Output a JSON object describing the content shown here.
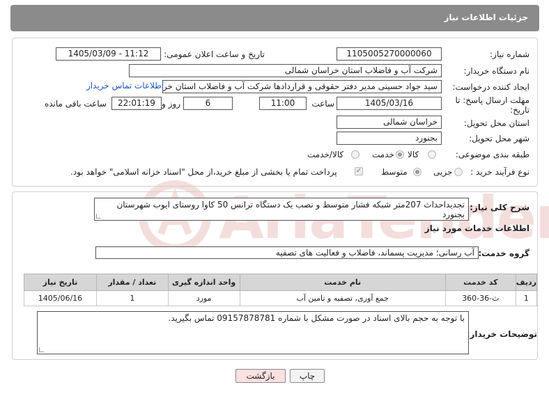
{
  "header": {
    "title": "جزئیات اطلاعات نیاز"
  },
  "form": {
    "need_number_label": "شماره نیاز:",
    "need_number": "1105005270000060",
    "announce_label": "تاریخ و ساعت اعلان عمومی:",
    "announce_value": "1405/03/09 - 11:12",
    "buyer_org_label": "نام دستگاه خریدار:",
    "buyer_org": "شرکت آب و فاضلاب استان خراسان شمالی",
    "creator_label": "ایجاد کننده درخواست:",
    "creator": "سید جواد حسینی مدیر دفتر حقوقی و قراردادها  شرکت آب و فاضلاب استان خراسان شمالی",
    "contact_link": "اطلاعات تماس خریدار",
    "deadline_label_1": "مهلت ارسال پاسخ: تا",
    "deadline_label_2": "تاریخ:",
    "deadline_date": "1405/03/16",
    "time_label": "ساعت",
    "deadline_time": "11:00",
    "days_value": "6",
    "days_label": "روز و",
    "remaining_time": "22:01:19",
    "remaining_label": "ساعت باقی مانده",
    "province_label": "استان محل تحویل:",
    "province": "خراسان شمالی",
    "city_label": "شهر محل تحویل:",
    "city": "بجنورد",
    "category_label": "طبقه بندی موضوعی:",
    "category_options": [
      "کالا",
      "خدمت",
      "کالا/خدمت"
    ],
    "category_selected": "خدمت",
    "process_label": "نوع فرآیند خرید :",
    "process_options": [
      "جزیی",
      "متوسط"
    ],
    "process_selected": "متوسط",
    "payment_note": "پرداخت تمام یا بخشی از مبلغ خرید،از محل \"اسناد خزانه اسلامی\" خواهد بود."
  },
  "description": {
    "label": "شرح کلی نیاز:",
    "text": "تجدیداحداث 207متر شبکه فشار متوسط و نصب یک دستگاه ترانس 50 کاوا روستای ایوب شهرستان بجنورد"
  },
  "services": {
    "section_title": "اطلاعات خدمات مورد نیاز",
    "group_label": "گروه خدمت:",
    "group_value": "آب رسانی؛ مدیریت پسماند، فاضلاب و فعالیت های تصفیه",
    "table": {
      "headers": [
        "ردیف",
        "کد خدمت",
        "نام خدمت",
        "واحد اندازه گیری",
        "تعداد / مقدار",
        "تاریخ نیاز"
      ],
      "rows": [
        [
          "1",
          "ث-36-360",
          "جمع آوری، تصفیه و تامین آب",
          "مورد",
          "1",
          "1405/06/16"
        ]
      ]
    }
  },
  "buyer_notes": {
    "label": "توضیحات خریدار:",
    "text": "با توجه به حجم بالای اسناد در صورت مشکل با شماره 09157878781 تماس بگیرید."
  },
  "buttons": {
    "print": "چاپ",
    "back": "بازگشت"
  },
  "watermark": {
    "text": "AriaTender.neT"
  },
  "colors": {
    "header_bg": "#8b8b8b",
    "link": "#1a57c8",
    "back_button": "#fde0e0",
    "table_header": "#d6d6d6"
  }
}
